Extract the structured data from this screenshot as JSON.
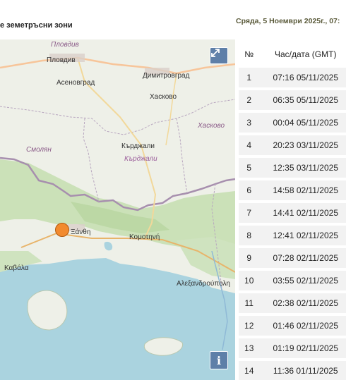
{
  "header": {
    "title": "е земетръсни зони",
    "date": "Сряда, 5 Ноември 2025г., 07:"
  },
  "map": {
    "labels": {
      "plovdiv_region": "Пловдив",
      "plovdiv": "Пловдив",
      "asenovgrad": "Асеновград",
      "dimitrovgrad": "Димитровград",
      "haskovo": "Хасково",
      "haskovo_region": "Хасково",
      "smolyan_region": "Смолян",
      "kardzhali": "Кърджали",
      "kardzhali_region": "Кърджали",
      "xanthi": "Ξάνθη",
      "komotini": "Κομοτηνή",
      "kavala": "Καβάλα",
      "alexandroupoli": "Αλεξανδρούπολη"
    },
    "fullscreen_icon": "fullscreen-icon",
    "info_label": "i",
    "colors": {
      "land": "#eef0e8",
      "sea": "#aad3df",
      "forest": "#b9d8a4",
      "border": "#9b8aa6",
      "marker": "#f28a2e"
    }
  },
  "table": {
    "headers": {
      "num": "№",
      "datetime": "Час/дата (GMT)"
    },
    "rows": [
      {
        "num": "1",
        "datetime": "07:16 05/11/2025"
      },
      {
        "num": "2",
        "datetime": "06:35 05/11/2025"
      },
      {
        "num": "3",
        "datetime": "00:04 05/11/2025"
      },
      {
        "num": "4",
        "datetime": "20:23 03/11/2025"
      },
      {
        "num": "5",
        "datetime": "12:35 03/11/2025"
      },
      {
        "num": "6",
        "datetime": "14:58 02/11/2025"
      },
      {
        "num": "7",
        "datetime": "14:41 02/11/2025"
      },
      {
        "num": "8",
        "datetime": "12:41 02/11/2025"
      },
      {
        "num": "9",
        "datetime": "07:28 02/11/2025"
      },
      {
        "num": "10",
        "datetime": "03:55 02/11/2025"
      },
      {
        "num": "11",
        "datetime": "02:38 02/11/2025"
      },
      {
        "num": "12",
        "datetime": "01:46 02/11/2025"
      },
      {
        "num": "13",
        "datetime": "01:19 02/11/2025"
      },
      {
        "num": "14",
        "datetime": "11:36 01/11/2025"
      }
    ]
  }
}
